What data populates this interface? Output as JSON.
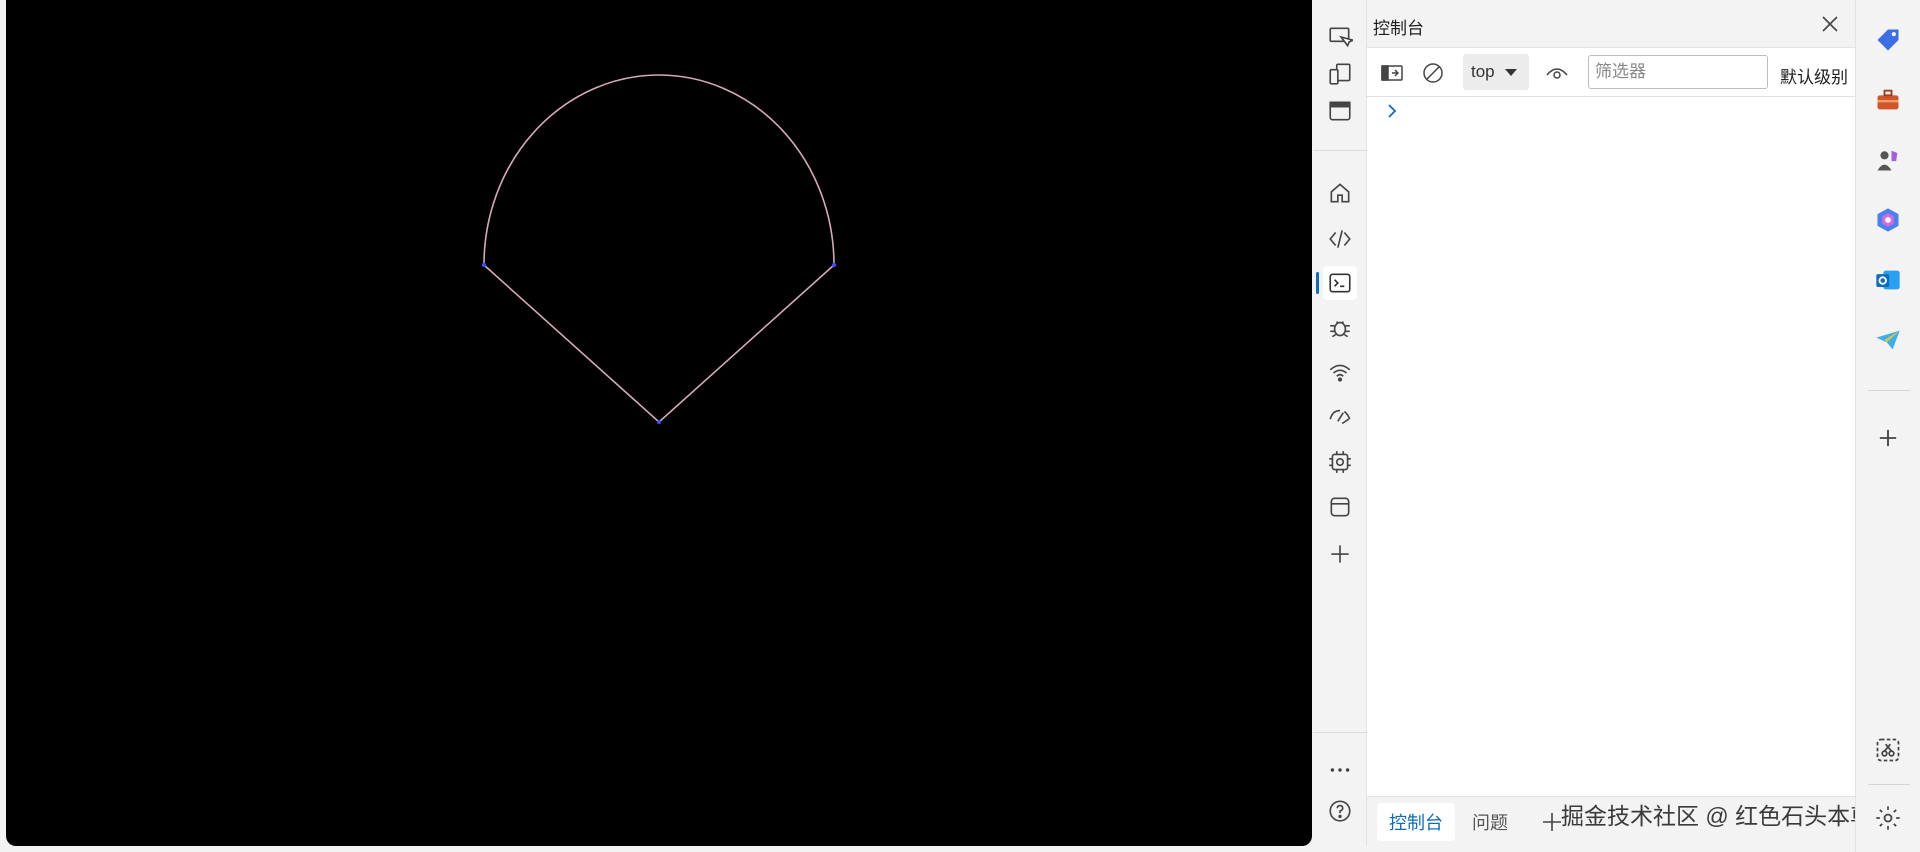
{
  "devtools": {
    "panel_title": "控制台",
    "context": "top",
    "filter_placeholder": "筛选器",
    "levels_label": "默认级别",
    "footer_tabs": [
      "控制台",
      "问题"
    ],
    "watermark": "掘金技术社区 @ 红色石头本尊"
  },
  "icons": {
    "activity": [
      "inspect-icon",
      "device-emulation-icon",
      "window-icon",
      "home-icon",
      "elements-icon",
      "console-icon",
      "sources-bug-icon",
      "network-wifi-icon",
      "performance-icon",
      "memory-chip-icon",
      "application-icon",
      "add-tool-icon",
      "more-icon",
      "help-icon"
    ],
    "sidebar": [
      "shopping-tag-icon",
      "tools-icon",
      "games-icon",
      "copilot-icon",
      "outlook-icon",
      "telegram-icon",
      "add-icon",
      "screenshot-icon"
    ]
  },
  "colors": {
    "accent": "#0f6cbd",
    "canvas_bg": "#000000",
    "arc": "#d6a8b8",
    "axis_x": "#d2a25a",
    "axis_y": "#7fbf2a",
    "axis_z": "#2f8fd0"
  }
}
